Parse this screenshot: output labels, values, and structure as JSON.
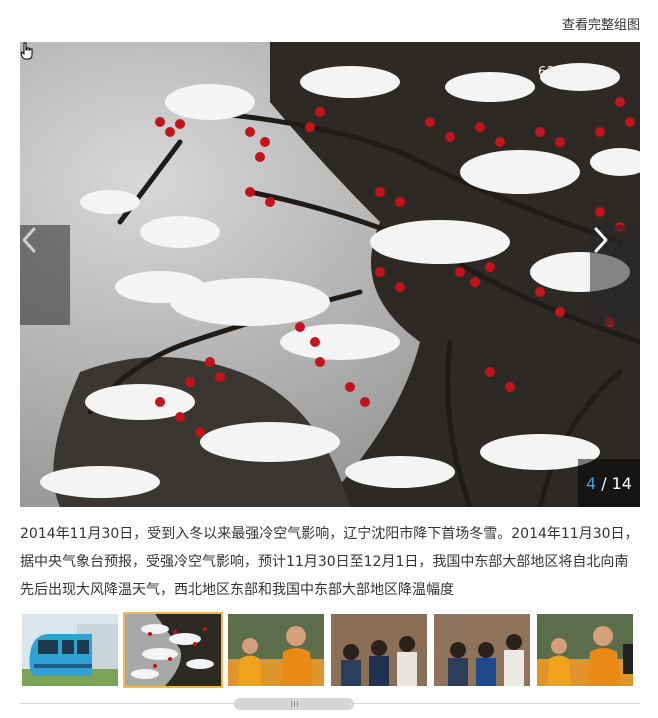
{
  "header": {
    "view_full_set": "查看完整组图"
  },
  "photo": {
    "size_label": "620X465",
    "current": "4",
    "separator": "/",
    "total": "14"
  },
  "nav": {
    "prev_icon": "chevron-left-icon",
    "next_icon": "chevron-right-icon"
  },
  "caption": "2014年11月30日，受到入冬以来最强冷空气影响，辽宁沈阳市降下首场冬雪。2014年11月30日，据中央气象台预报，受强冷空气影响，预计11月30日至12月1日，我国中东部大部地区将自北向南先后出现大风降温天气，西北地区东部和我国中东部大部地区降温幅度",
  "thumbnails": [
    {
      "subject": "train"
    },
    {
      "subject": "snowy-berries",
      "active": true
    },
    {
      "subject": "monks"
    },
    {
      "subject": "students"
    },
    {
      "subject": "students"
    },
    {
      "subject": "monks"
    }
  ],
  "colors": {
    "accent_blue": "#3ea0e6",
    "active_border": "#f5b94a"
  }
}
